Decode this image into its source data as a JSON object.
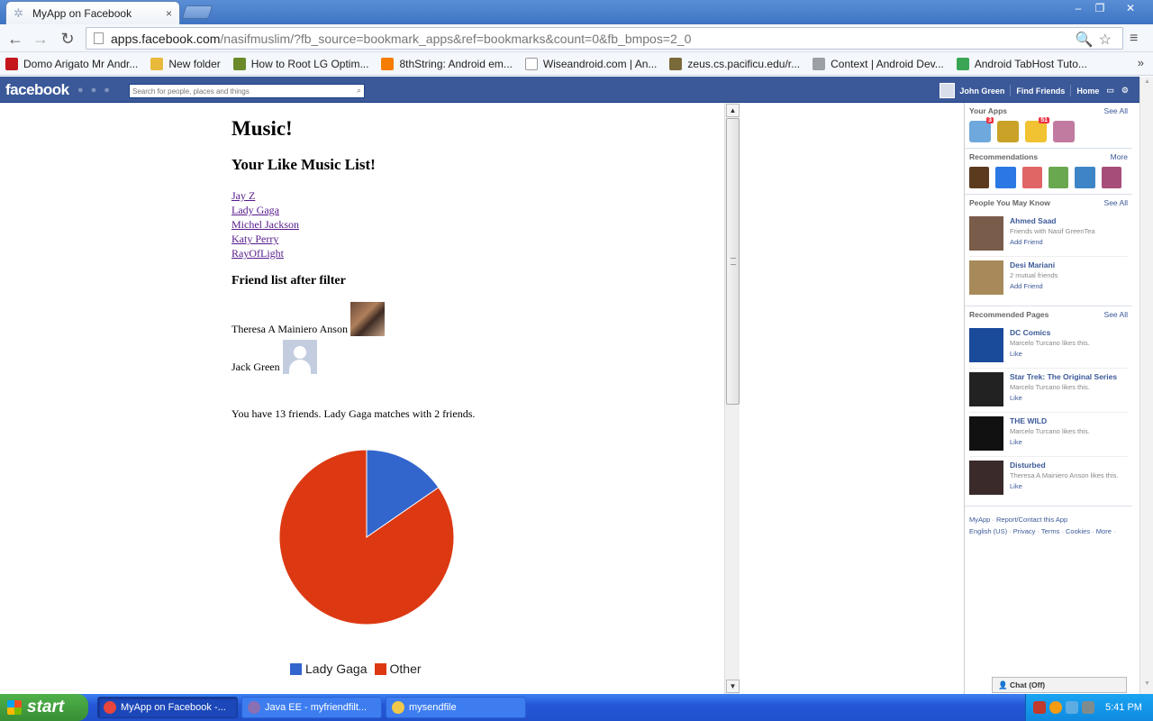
{
  "browser": {
    "tab_title": "MyApp on Facebook",
    "tab_close": "×",
    "window_buttons": {
      "minimize": "–",
      "maximize": "❐",
      "close": "✕"
    },
    "nav": {
      "back": "←",
      "forward": "→",
      "reload": "↻"
    },
    "url_host": "apps.facebook.com",
    "url_path": "/nasifmuslim/?fb_source=bookmark_apps&ref=bookmarks&count=0&fb_bmpos=2_0",
    "omnibox_icons": "🔍☆",
    "menu": "≡",
    "bookmarks": [
      {
        "label": "Domo Arigato Mr Andr...",
        "color": "#c4161c"
      },
      {
        "label": "New folder",
        "color": "#e8b93a"
      },
      {
        "label": "How to Root LG Optim...",
        "color": "#6a8a2a"
      },
      {
        "label": "8thString: Android em...",
        "color": "#f57d00"
      },
      {
        "label": "Wiseandroid.com | An...",
        "color": "#ffffff"
      },
      {
        "label": "zeus.cs.pacificu.edu/r...",
        "color": "#7a6a3a"
      },
      {
        "label": "Context | Android Dev...",
        "color": "#9aa0a6"
      },
      {
        "label": "Android TabHost Tuto...",
        "color": "#3aa655"
      }
    ],
    "bookmarks_more": "»"
  },
  "facebook": {
    "logo": "facebook",
    "search_placeholder": "Search for people, places and things",
    "user_name": "John Green",
    "find_friends": "Find Friends",
    "home": "Home"
  },
  "app": {
    "title": "Music!",
    "like_heading": "Your Like Music List!",
    "music_list": [
      "Jay Z",
      "Lady Gaga",
      "Michel Jackson",
      "Katy Perry",
      "RayOfLight"
    ],
    "friends_heading": "Friend list after filter",
    "friends": [
      {
        "name": "Theresa A Mainiero Anson"
      },
      {
        "name": "Jack Green"
      }
    ],
    "summary": "You have 13 friends. Lady Gaga matches with 2 friends."
  },
  "chart_data": {
    "type": "pie",
    "labels": [
      "Lady Gaga",
      "Other"
    ],
    "values": [
      2,
      11
    ],
    "colors": [
      "#3366cc",
      "#dc3912"
    ]
  },
  "sidebar": {
    "your_apps": {
      "heading": "Your Apps",
      "see_all": "See All",
      "apps": [
        {
          "color": "#6fa8dc",
          "badge": "3"
        },
        {
          "color": "#c9a227",
          "badge": ""
        },
        {
          "color": "#f1c232",
          "badge": "51"
        },
        {
          "color": "#c27ba0",
          "badge": ""
        }
      ]
    },
    "recommendations": {
      "heading": "Recommendations",
      "more": "More",
      "apps": [
        "#5b3a1e",
        "#2b78e4",
        "#e06666",
        "#6aa84f",
        "#3d85c6",
        "#a64d79"
      ]
    },
    "people": {
      "heading": "People You May Know",
      "see_all": "See All",
      "items": [
        {
          "name": "Ahmed Saad",
          "sub": "Friends with Nasif GreenTea",
          "action": "Add Friend",
          "color": "#7a5c4a"
        },
        {
          "name": "Desi Mariani",
          "sub": "2 mutual friends",
          "action": "Add Friend",
          "color": "#a88a5a"
        }
      ]
    },
    "pages": {
      "heading": "Recommended Pages",
      "see_all": "See All",
      "items": [
        {
          "name": "DC Comics",
          "sub": "Marcelo Turcano likes this.",
          "action": "Like",
          "color": "#1a4a9a"
        },
        {
          "name": "Star Trek: The Original Series",
          "sub": "Marcelo Turcano likes this.",
          "action": "Like",
          "color": "#222222"
        },
        {
          "name": "THE WILD",
          "sub": "Marcelo Turcano likes this.",
          "action": "Like",
          "color": "#111111"
        },
        {
          "name": "Disturbed",
          "sub": "Theresa A Mainiero Anson likes this.",
          "action": "Like",
          "color": "#3a2a2a"
        }
      ]
    },
    "footer": {
      "app_name": "MyApp",
      "report": "Report/Contact this App",
      "language": "English (US)",
      "privacy": "Privacy",
      "terms": "Terms",
      "cookies": "Cookies",
      "more": "More"
    },
    "chat": "Chat (Off)"
  },
  "taskbar": {
    "start": "start",
    "tasks": [
      {
        "label": "MyApp on Facebook -...",
        "color": "#e8453c"
      },
      {
        "label": "Java EE - myfriendfilt...",
        "color": "#8a6fb3"
      },
      {
        "label": "mysendfile",
        "color": "#f0c84a"
      }
    ],
    "clock": "5:41 PM"
  }
}
